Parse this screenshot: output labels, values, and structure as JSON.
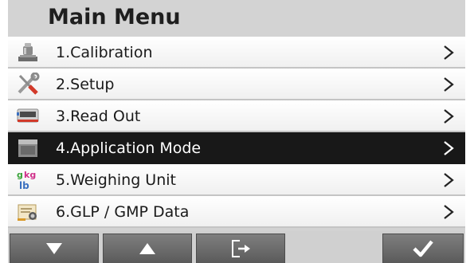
{
  "title": "Main Menu",
  "menu_items": [
    {
      "label": "1.Calibration",
      "icon": "calibration-weight-icon",
      "selected": false
    },
    {
      "label": "2.Setup",
      "icon": "tools-icon",
      "selected": false
    },
    {
      "label": "3.Read Out",
      "icon": "display-icon",
      "selected": false
    },
    {
      "label": "4.Application Mode",
      "icon": "application-mode-icon",
      "selected": true
    },
    {
      "label": "5.Weighing Unit",
      "icon": "weighing-unit-icon",
      "selected": false
    },
    {
      "label": "6.GLP / GMP Data",
      "icon": "glp-certificate-icon",
      "selected": false
    }
  ],
  "toolbar": {
    "down": {
      "icon": "arrow-down-icon"
    },
    "up": {
      "icon": "arrow-up-icon"
    },
    "exit": {
      "icon": "exit-door-icon"
    },
    "confirm": {
      "icon": "checkmark-icon"
    }
  },
  "colors": {
    "selected_row": "#181818",
    "toolbar_button": "#6b6b6b",
    "background": "#d3d3d3"
  }
}
